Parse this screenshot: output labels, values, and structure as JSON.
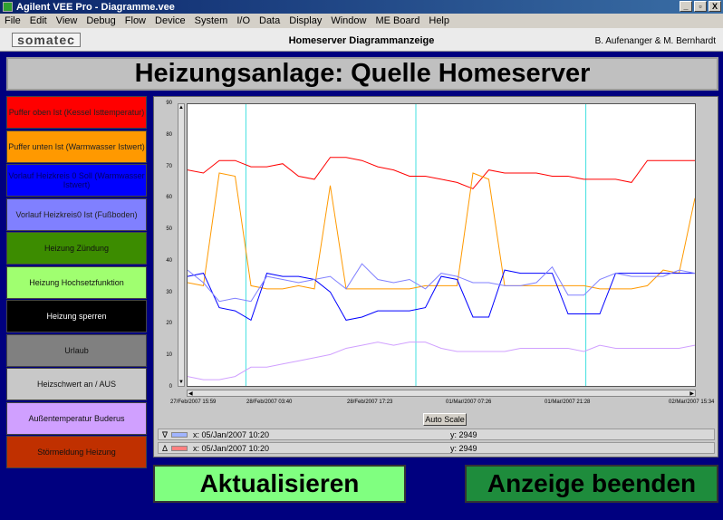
{
  "window": {
    "title": "Agilent VEE Pro - Diagramme.vee",
    "minimize": "_",
    "restore": "▫",
    "close": "X"
  },
  "menu": [
    "File",
    "Edit",
    "View",
    "Debug",
    "Flow",
    "Device",
    "System",
    "I/O",
    "Data",
    "Display",
    "Window",
    "ME Board",
    "Help"
  ],
  "header": {
    "logo": "somatec",
    "title": "Homeserver Diagrammanzeige",
    "authors": "B. Aufenanger & M. Bernhardt"
  },
  "page_title": "Heizungsanlage: Quelle Homeserver",
  "legend": [
    {
      "label": "Puffer oben Ist (Kessel Isttemperatur)",
      "color": "#ff0000",
      "text": "#222222"
    },
    {
      "label": "Puffer unten Ist (Warmwasser Istwert)",
      "color": "#ff9900",
      "text": "#222222"
    },
    {
      "label": "Vorlauf Heizkreis 0 Soll (Warmwasser Istwert)",
      "color": "#0000ff",
      "text": "#000066"
    },
    {
      "label": "Vorlauf Heizkreis0 Ist (Fußboden)",
      "color": "#8080ff",
      "text": "#222222"
    },
    {
      "label": "Heizung Zündung",
      "color": "#3c8c00",
      "text": "#111111"
    },
    {
      "label": "Heizung Hochsetzfunktion",
      "color": "#a0ff70",
      "text": "#111111"
    },
    {
      "label": "Heizung sperren",
      "color": "#000000",
      "text": "#ffffff"
    },
    {
      "label": "Urlaub",
      "color": "#808080",
      "text": "#111111"
    },
    {
      "label": "Heizschwert an / AUS",
      "color": "#c8c8c8",
      "text": "#111111"
    },
    {
      "label": "Außentemperatur Buderus",
      "color": "#d0a0ff",
      "text": "#111111"
    },
    {
      "label": "Störmeldung Heizung",
      "color": "#c03000",
      "text": "#111111"
    }
  ],
  "chart_data": {
    "type": "line",
    "ylim": [
      0,
      90
    ],
    "yticks": [
      "90",
      "80",
      "70",
      "60",
      "50",
      "40",
      "30",
      "20",
      "10",
      "0"
    ],
    "xticks": [
      "27/Feb/2007 15:59",
      "28/Feb/2007 03:40",
      "28/Feb/2007 17:23",
      "01/Mar/2007 07:26",
      "01/Mar/2007 21:28",
      "02/Mar/2007 15:34"
    ],
    "grid": false,
    "series": [
      {
        "color": "#ff0000",
        "values": [
          69,
          68,
          72,
          72,
          70,
          70,
          71,
          67,
          66,
          73,
          73,
          72,
          70,
          69,
          67,
          67,
          66,
          65,
          63,
          69,
          68,
          68,
          68,
          67,
          67,
          66,
          66,
          66,
          65,
          72,
          72,
          72,
          72
        ]
      },
      {
        "color": "#ff9900",
        "values": [
          33,
          32,
          68,
          67,
          32,
          31,
          31,
          32,
          31,
          64,
          31,
          31,
          31,
          31,
          31,
          32,
          32,
          32,
          68,
          66,
          32,
          32,
          32,
          32,
          32,
          32,
          31,
          31,
          31,
          32,
          37,
          36,
          60
        ]
      },
      {
        "color": "#0000ff",
        "values": [
          35,
          36,
          25,
          24,
          21,
          36,
          35,
          35,
          34,
          30,
          21,
          22,
          24,
          24,
          24,
          25,
          35,
          34,
          22,
          22,
          37,
          36,
          36,
          36,
          23,
          23,
          23,
          36,
          36,
          36,
          36,
          36,
          36
        ]
      },
      {
        "color": "#8080ff",
        "values": [
          37,
          33,
          27,
          28,
          27,
          35,
          34,
          33,
          34,
          35,
          31,
          39,
          34,
          33,
          34,
          31,
          36,
          35,
          33,
          33,
          32,
          32,
          33,
          38,
          29,
          29,
          34,
          36,
          35,
          35,
          35,
          37,
          36
        ]
      },
      {
        "color": "#d0a0ff",
        "values": [
          3,
          2,
          2,
          3,
          6,
          6,
          7,
          8,
          9,
          10,
          12,
          13,
          14,
          13,
          14,
          14,
          12,
          11,
          11,
          11,
          11,
          12,
          12,
          12,
          12,
          11,
          13,
          12,
          12,
          12,
          12,
          12,
          13
        ]
      }
    ],
    "vlines": [
      0.115,
      0.45,
      0.785
    ]
  },
  "autoscale": "Auto Scale",
  "cursors": [
    {
      "sym": "∇",
      "swatch": "#a0b4ff",
      "x": "x: 05/Jan/2007  10:20",
      "y": "y: 2949"
    },
    {
      "sym": "Δ",
      "swatch": "#ff8080",
      "x": "x: 05/Jan/2007  10:20",
      "y": "y: 2949"
    }
  ],
  "buttons": {
    "refresh": "Aktualisieren",
    "exit": "Anzeige beenden"
  }
}
